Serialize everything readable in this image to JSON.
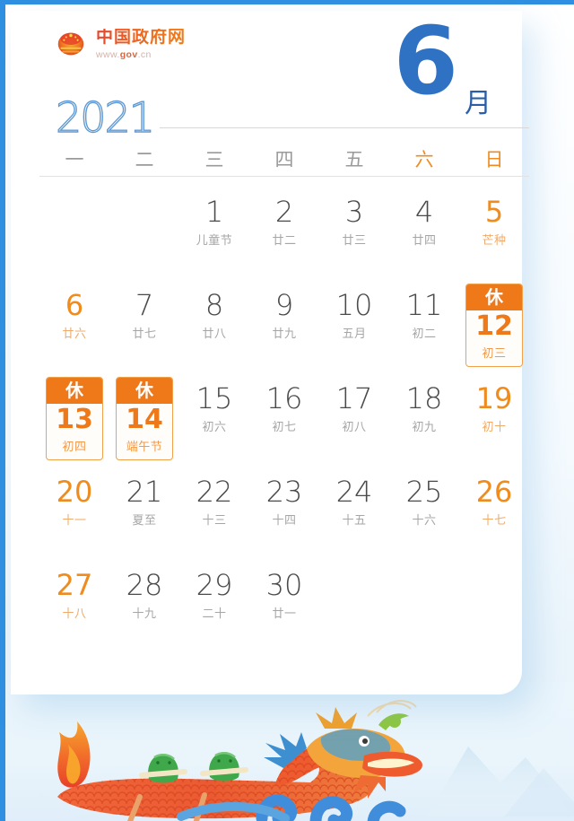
{
  "brand": {
    "name": "中国政府网",
    "url_prefix": "www.",
    "url_mid": "gov",
    "url_suffix": ".cn",
    "emblem_icon": "china-national-emblem-icon"
  },
  "header": {
    "month_number": "6",
    "month_unit": "月",
    "year": "2021"
  },
  "colors": {
    "accent_blue": "#2f72c4",
    "accent_orange": "#ef7818",
    "weekend_orange": "#ef8c20",
    "frame_blue": "#2f8fe0",
    "text_gray": "#4a4a4a",
    "sub_gray": "#a6a6a6"
  },
  "weekdays": [
    {
      "label": "一",
      "weekend": false
    },
    {
      "label": "二",
      "weekend": false
    },
    {
      "label": "三",
      "weekend": false
    },
    {
      "label": "四",
      "weekend": false
    },
    {
      "label": "五",
      "weekend": false
    },
    {
      "label": "六",
      "weekend": true
    },
    {
      "label": "日",
      "weekend": true
    }
  ],
  "rest_badge_label": "休",
  "days": [
    {
      "blank": true
    },
    {
      "blank": true
    },
    {
      "num": "1",
      "sub": "儿童节",
      "weekend": false,
      "rest": false
    },
    {
      "num": "2",
      "sub": "廿二",
      "weekend": false,
      "rest": false
    },
    {
      "num": "3",
      "sub": "廿三",
      "weekend": false,
      "rest": false
    },
    {
      "num": "4",
      "sub": "廿四",
      "weekend": false,
      "rest": false
    },
    {
      "num": "5",
      "sub": "芒种",
      "weekend": true,
      "rest": false
    },
    {
      "num": "6",
      "sub": "廿六",
      "weekend": true,
      "rest": false
    },
    {
      "num": "7",
      "sub": "廿七",
      "weekend": false,
      "rest": false
    },
    {
      "num": "8",
      "sub": "廿八",
      "weekend": false,
      "rest": false
    },
    {
      "num": "9",
      "sub": "廿九",
      "weekend": false,
      "rest": false
    },
    {
      "num": "10",
      "sub": "五月",
      "weekend": false,
      "rest": false
    },
    {
      "num": "11",
      "sub": "初二",
      "weekend": false,
      "rest": false
    },
    {
      "num": "12",
      "sub": "初三",
      "weekend": true,
      "rest": true
    },
    {
      "num": "13",
      "sub": "初四",
      "weekend": true,
      "rest": true
    },
    {
      "num": "14",
      "sub": "端午节",
      "weekend": false,
      "rest": true
    },
    {
      "num": "15",
      "sub": "初六",
      "weekend": false,
      "rest": false
    },
    {
      "num": "16",
      "sub": "初七",
      "weekend": false,
      "rest": false
    },
    {
      "num": "17",
      "sub": "初八",
      "weekend": false,
      "rest": false
    },
    {
      "num": "18",
      "sub": "初九",
      "weekend": false,
      "rest": false
    },
    {
      "num": "19",
      "sub": "初十",
      "weekend": true,
      "rest": false
    },
    {
      "num": "20",
      "sub": "十一",
      "weekend": true,
      "rest": false
    },
    {
      "num": "21",
      "sub": "夏至",
      "weekend": false,
      "rest": false
    },
    {
      "num": "22",
      "sub": "十三",
      "weekend": false,
      "rest": false
    },
    {
      "num": "23",
      "sub": "十四",
      "weekend": false,
      "rest": false
    },
    {
      "num": "24",
      "sub": "十五",
      "weekend": false,
      "rest": false
    },
    {
      "num": "25",
      "sub": "十六",
      "weekend": false,
      "rest": false
    },
    {
      "num": "26",
      "sub": "十七",
      "weekend": true,
      "rest": false
    },
    {
      "num": "27",
      "sub": "十八",
      "weekend": true,
      "rest": false
    },
    {
      "num": "28",
      "sub": "十九",
      "weekend": false,
      "rest": false
    },
    {
      "num": "29",
      "sub": "二十",
      "weekend": false,
      "rest": false
    },
    {
      "num": "30",
      "sub": "廿一",
      "weekend": false,
      "rest": false
    }
  ],
  "illustration": {
    "name": "dragon-boat-festival-illustration",
    "elements": [
      "dragon-boat",
      "zongzi-rice-dumpling",
      "blue-waves",
      "misty-mountains",
      "flame-tail"
    ]
  }
}
